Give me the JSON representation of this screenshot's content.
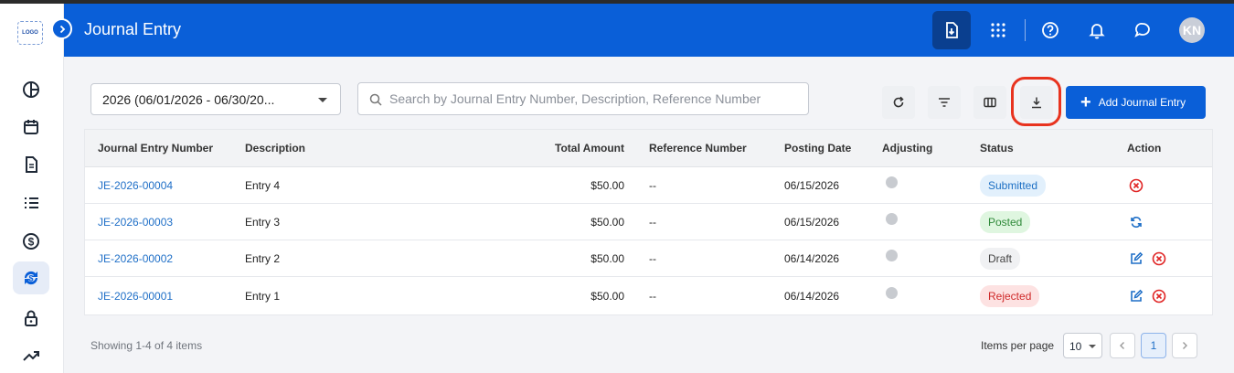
{
  "header": {
    "title": "Journal Entry",
    "avatar_initials": "KN",
    "brand_color": "#0a5fd8"
  },
  "logo_text": "LOGO",
  "filters": {
    "period_value": "2026 (06/01/2026 - 06/30/20...",
    "search_placeholder": "Search by Journal Entry Number, Description, Reference Number"
  },
  "toolbar": {
    "add_label": "Add Journal Entry"
  },
  "table": {
    "columns": [
      "Journal Entry Number",
      "Description",
      "Total Amount",
      "Reference Number",
      "Posting Date",
      "Adjusting",
      "Status",
      "Action"
    ],
    "rows": [
      {
        "number": "JE-2026-00004",
        "description": "Entry 4",
        "amount": "$50.00",
        "reference": "--",
        "posting_date": "06/15/2026",
        "status": "Submitted",
        "actions": [
          "cancel"
        ]
      },
      {
        "number": "JE-2026-00003",
        "description": "Entry 3",
        "amount": "$50.00",
        "reference": "--",
        "posting_date": "06/15/2026",
        "status": "Posted",
        "actions": [
          "sync"
        ]
      },
      {
        "number": "JE-2026-00002",
        "description": "Entry 2",
        "amount": "$50.00",
        "reference": "--",
        "posting_date": "06/14/2026",
        "status": "Draft",
        "actions": [
          "edit",
          "cancel"
        ]
      },
      {
        "number": "JE-2026-00001",
        "description": "Entry 1",
        "amount": "$50.00",
        "reference": "--",
        "posting_date": "06/14/2026",
        "status": "Rejected",
        "actions": [
          "edit",
          "cancel"
        ]
      }
    ]
  },
  "pagination": {
    "summary": "Showing 1-4 of 4 items",
    "items_per_page_label": "Items per page",
    "items_per_page": "10",
    "current_page": "1"
  }
}
